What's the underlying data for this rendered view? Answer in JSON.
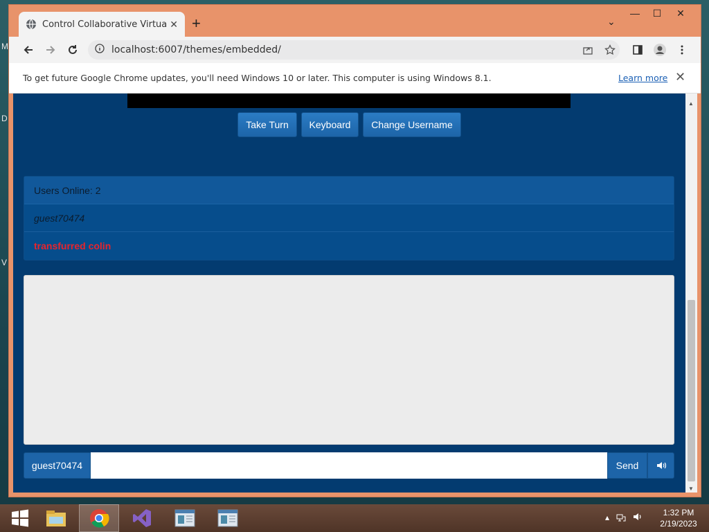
{
  "desktop": {
    "side_glyphs": [
      "M",
      "D",
      "V"
    ]
  },
  "browser": {
    "tab_title": "Control Collaborative Virtual Ma",
    "url": "localhost:6007/themes/embedded/",
    "infobar_message": "To get future Google Chrome updates, you'll need Windows 10 or later. This computer is using Windows 8.1.",
    "infobar_link": "Learn more"
  },
  "page": {
    "buttons": {
      "take_turn": "Take Turn",
      "keyboard": "Keyboard",
      "change_username": "Change Username"
    },
    "users_panel": {
      "header": "Users Online: 2",
      "users": [
        "guest70474",
        "transfurred colin"
      ]
    },
    "chat": {
      "username": "guest70474",
      "input_value": "",
      "send_label": "Send"
    }
  },
  "taskbar": {
    "apps": [
      "windows-start",
      "file-explorer",
      "chrome",
      "visual-studio",
      "window-1",
      "window-2"
    ],
    "clock_time": "1:32 PM",
    "clock_date": "2/19/2023"
  },
  "colors": {
    "page_background": "#033b70",
    "button_blue": "#1d64a8",
    "other_user_red": "#e8242c",
    "window_frame": "#e8936a"
  }
}
